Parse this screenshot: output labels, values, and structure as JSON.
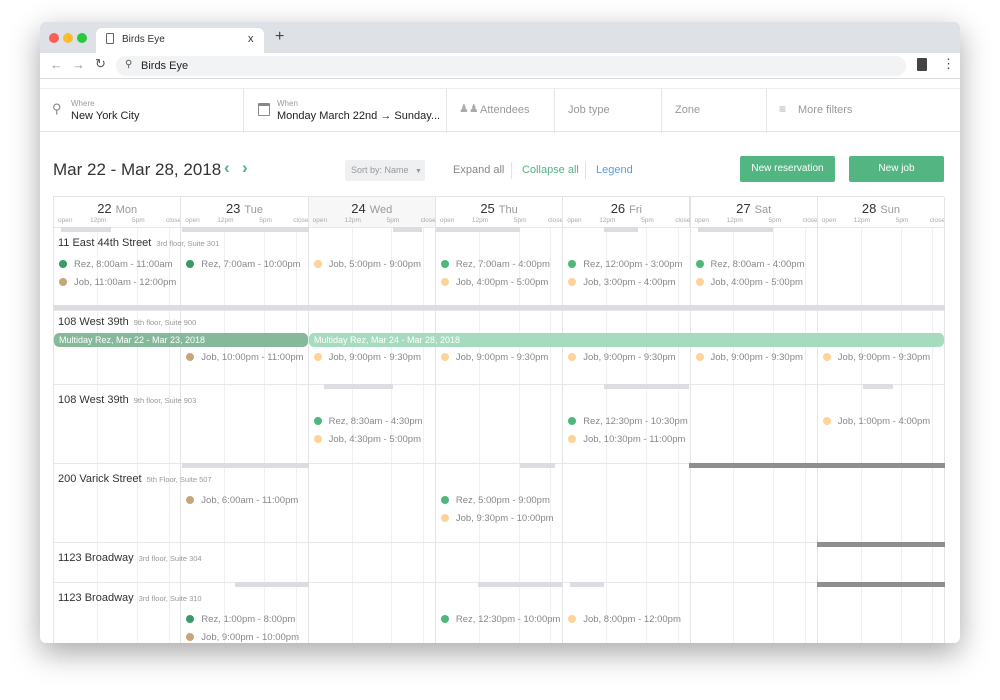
{
  "browser": {
    "tab_title": "Birds Eye",
    "address": "Birds Eye",
    "new_tab": "+",
    "close": "x"
  },
  "filters": {
    "where_label": "Where",
    "where_value": "New York City",
    "when_label": "When",
    "when_value": "Monday March 22nd → Sunday...",
    "attendees": "Attendees",
    "job_type": "Job type",
    "zone": "Zone",
    "more_filters": "More filters"
  },
  "toolbar": {
    "range": "Mar 22 - Mar 28, 2018",
    "sort": "Sort by: Name",
    "expand": "Expand all",
    "collapse": "Collapse all",
    "legend": "Legend",
    "new_reservation": "New reservation",
    "new_job": "New job"
  },
  "colors": {
    "accent": "#52b582",
    "rez_past": "#3a9a64",
    "rez": "#4cb87a",
    "job_past": "#c9a57a",
    "job": "#fdd39a",
    "legend_link": "#5a9be0"
  },
  "ticks": [
    "open",
    "12pm",
    "5pm",
    "close"
  ],
  "days": [
    {
      "num": "22",
      "name": "Mon"
    },
    {
      "num": "23",
      "name": "Tue"
    },
    {
      "num": "24",
      "name": "Wed"
    },
    {
      "num": "25",
      "name": "Thu"
    },
    {
      "num": "26",
      "name": "Fri"
    },
    {
      "num": "27",
      "name": "Sat"
    },
    {
      "num": "28",
      "name": "Sun"
    }
  ],
  "rows": [
    {
      "name": "11 East 44th Street",
      "sub": "3rd floor, Suite 301",
      "events": [
        [
          {
            "text": "Rez, 8:00am - 11:00am",
            "color": "#3a9a64"
          },
          {
            "text": "Job, 11:00am - 12:00pm",
            "color": "#c9a57a"
          }
        ],
        [
          {
            "text": "Rez, 7:00am - 10:00pm",
            "color": "#3a9a64"
          }
        ],
        [
          {
            "text": "Job, 5:00pm - 9:00pm",
            "color": "#fdd39a"
          }
        ],
        [
          {
            "text": "Rez, 7:00am - 4:00pm",
            "color": "#4cb87a"
          },
          {
            "text": "Job, 4:00pm - 5:00pm",
            "color": "#fdd39a"
          }
        ],
        [
          {
            "text": "Rez, 12:00pm - 3:00pm",
            "color": "#4cb87a"
          },
          {
            "text": "Job, 3:00pm - 4:00pm",
            "color": "#fdd39a"
          }
        ],
        [
          {
            "text": "Rez, 8:00am - 4:00pm",
            "color": "#4cb87a"
          },
          {
            "text": "Job, 4:00pm - 5:00pm",
            "color": "#fdd39a"
          }
        ],
        []
      ]
    },
    {
      "name": "108 West 39th",
      "sub": "9th floor, Suite 900",
      "multiday": [
        {
          "text": "Multiday Rez, Mar 22 - Mar 23, 2018",
          "color": "#86b89a"
        },
        {
          "text": "Multiday Rez, Mar 24 - Mar 28, 2018",
          "color": "#a6dbbf"
        }
      ],
      "events": [
        [],
        [
          {
            "text": "Job, 10:00pm - 11:00pm",
            "color": "#c9a57a"
          }
        ],
        [
          {
            "text": "Job, 9:00pm - 9:30pm",
            "color": "#fdd39a"
          }
        ],
        [
          {
            "text": "Job, 9:00pm - 9:30pm",
            "color": "#fdd39a"
          }
        ],
        [
          {
            "text": "Job, 9:00pm - 9:30pm",
            "color": "#fdd39a"
          }
        ],
        [
          {
            "text": "Job, 9:00pm - 9:30pm",
            "color": "#fdd39a"
          }
        ],
        [
          {
            "text": "Job, 9:00pm - 9:30pm",
            "color": "#fdd39a"
          }
        ]
      ]
    },
    {
      "name": "108 West 39th",
      "sub": "9th floor, Suite 903",
      "events": [
        [],
        [],
        [
          {
            "text": "Rez, 8:30am - 4:30pm",
            "color": "#4cb87a"
          },
          {
            "text": "Job, 4:30pm - 5:00pm",
            "color": "#fdd39a"
          }
        ],
        [],
        [
          {
            "text": "Rez, 12:30pm - 10:30pm",
            "color": "#4cb87a"
          },
          {
            "text": "Job, 10:30pm - 11:00pm",
            "color": "#fdd39a"
          }
        ],
        [],
        [
          {
            "text": "Job, 1:00pm - 4:00pm",
            "color": "#fdd39a"
          }
        ]
      ]
    },
    {
      "name": "200 Varick Street",
      "sub": "5th Floor, Suite 507",
      "events": [
        [],
        [
          {
            "text": "Job, 6:00am - 11:00pm",
            "color": "#c9a57a"
          }
        ],
        [],
        [
          {
            "text": "Rez, 5:00pm - 9:00pm",
            "color": "#4cb87a"
          },
          {
            "text": "Job, 9:30pm - 10:00pm",
            "color": "#fdd39a"
          }
        ],
        [],
        [],
        []
      ]
    },
    {
      "name": "1123 Broadway",
      "sub": "3rd floor, Suite 304",
      "events": [
        [],
        [],
        [],
        [],
        [],
        [],
        []
      ]
    },
    {
      "name": "1123 Broadway",
      "sub": "3rd floor, Suite 310",
      "events": [
        [],
        [
          {
            "text": "Rez, 1:00pm - 8:00pm",
            "color": "#3a9a64"
          },
          {
            "text": "Job, 9:00pm - 10:00pm",
            "color": "#c9a57a"
          }
        ],
        [],
        [
          {
            "text": "Rez, 12:30pm - 10:00pm",
            "color": "#4cb87a"
          }
        ],
        [
          {
            "text": "Job, 8:00pm - 12:00pm",
            "color": "#fdd39a"
          }
        ],
        [],
        []
      ]
    }
  ]
}
